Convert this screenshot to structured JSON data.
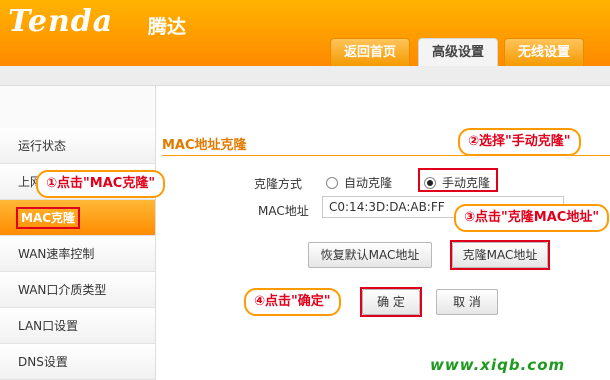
{
  "brand": {
    "logo_text": "Tenda",
    "logo_cn": "腾达"
  },
  "tabs": [
    {
      "label": "返回首页"
    },
    {
      "label": "高级设置"
    },
    {
      "label": "无线设置"
    }
  ],
  "sidebar": {
    "items": [
      {
        "label": "运行状态"
      },
      {
        "label": "上网设置"
      },
      {
        "label": "MAC克隆"
      },
      {
        "label": "WAN速率控制"
      },
      {
        "label": "WAN口介质类型"
      },
      {
        "label": "LAN口设置"
      },
      {
        "label": "DNS设置"
      }
    ]
  },
  "main": {
    "title": "MAC地址克隆",
    "clone_mode_label": "克隆方式",
    "radio_auto": "自动克隆",
    "radio_manual": "手动克隆",
    "mac_label": "MAC地址",
    "mac_value": "C0:14:3D:DA:AB:FF",
    "restore_button": "恢复默认MAC地址",
    "clone_button": "克隆MAC地址",
    "ok_button": "确 定",
    "cancel_button": "取 消"
  },
  "callouts": {
    "step1": "①点击\"MAC克隆\"",
    "step2": "②选择\"手动克隆\"",
    "step3": "③点击\"克隆MAC地址\"",
    "step4": "④点击\"确定\""
  },
  "watermark": "www.xiqb.com",
  "colors": {
    "brand_orange": "#ff9a00",
    "highlight_red": "#e0001b",
    "title_orange": "#e07b00"
  }
}
